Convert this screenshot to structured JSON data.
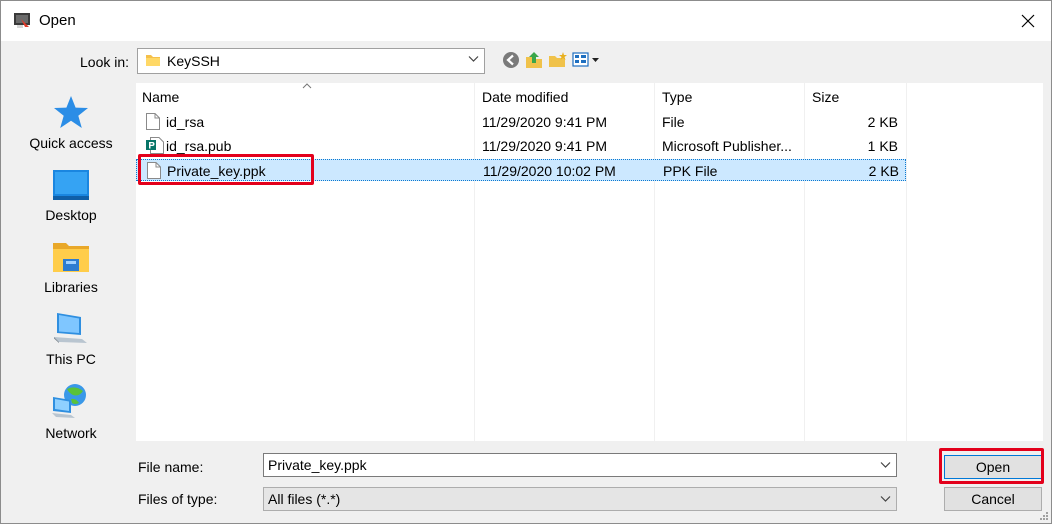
{
  "window": {
    "title": "Open"
  },
  "toolbar": {
    "look_in_label": "Look in:",
    "look_in_value": "KeySSH"
  },
  "places": [
    {
      "label": "Quick access",
      "icon": "star-icon"
    },
    {
      "label": "Desktop",
      "icon": "desktop-icon"
    },
    {
      "label": "Libraries",
      "icon": "libraries-icon"
    },
    {
      "label": "This PC",
      "icon": "computer-icon"
    },
    {
      "label": "Network",
      "icon": "network-icon"
    }
  ],
  "columns": {
    "name": "Name",
    "date": "Date modified",
    "type": "Type",
    "size": "Size"
  },
  "files": [
    {
      "name": "id_rsa",
      "date": "11/29/2020 9:41 PM",
      "type": "File",
      "size": "2 KB"
    },
    {
      "name": "id_rsa.pub",
      "date": "11/29/2020 9:41 PM",
      "type": "Microsoft Publisher...",
      "size": "1 KB"
    },
    {
      "name": "Private_key.ppk",
      "date": "11/29/2020 10:02 PM",
      "type": "PPK File",
      "size": "2 KB"
    }
  ],
  "selected_file": "Private_key.ppk",
  "footer": {
    "file_name_label": "File name:",
    "file_name_value": "Private_key.ppk",
    "file_type_label": "Files of type:",
    "file_type_value": "All files (*.*)",
    "open_label": "Open",
    "cancel_label": "Cancel"
  },
  "colors": {
    "selection": "#cce8ff",
    "highlight": "#e3001b",
    "accent": "#0078d7"
  }
}
